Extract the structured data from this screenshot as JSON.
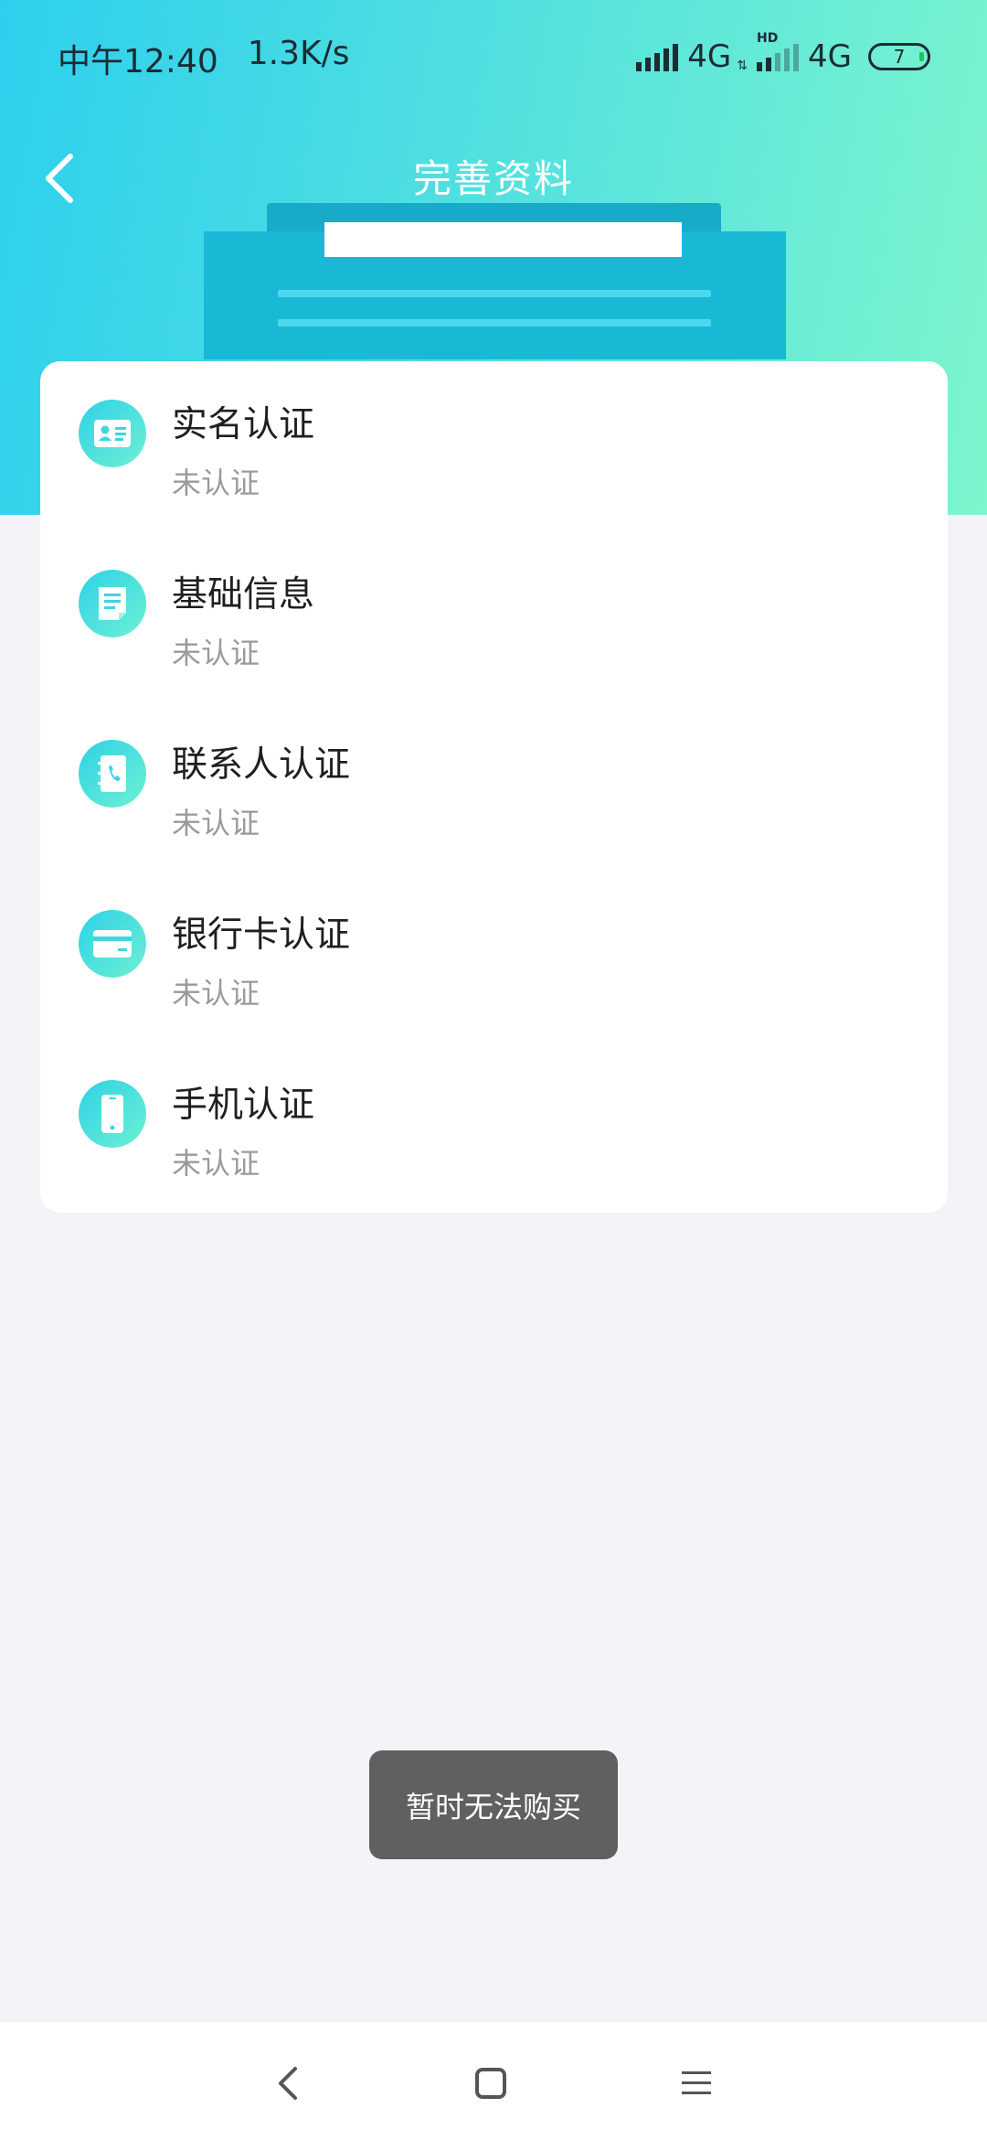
{
  "status_bar": {
    "time": "中午12:40",
    "net_speed": "1.3K/s",
    "network_1": "4G",
    "network_2": "4G",
    "hd_label": "HD",
    "battery": "7"
  },
  "header": {
    "title": "完善资料"
  },
  "verification_items": [
    {
      "title": "实名认证",
      "status": "未认证",
      "icon": "id-card-icon"
    },
    {
      "title": "基础信息",
      "status": "未认证",
      "icon": "document-icon"
    },
    {
      "title": "联系人认证",
      "status": "未认证",
      "icon": "contacts-book-icon"
    },
    {
      "title": "银行卡认证",
      "status": "未认证",
      "icon": "bank-card-icon"
    },
    {
      "title": "手机认证",
      "status": "未认证",
      "icon": "mobile-phone-icon"
    }
  ],
  "toast": {
    "message": "暂时无法购买"
  },
  "colors": {
    "header_gradient_start": "#2ecfee",
    "header_gradient_end": "#7df5cd",
    "icon_gradient_start": "#2fd2e6",
    "icon_gradient_end": "#6df0d4",
    "page_background": "#f5f2f8"
  }
}
